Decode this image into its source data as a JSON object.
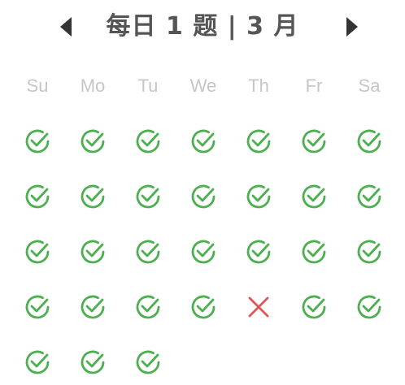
{
  "header": {
    "title": "每日 1 题 | 3 月",
    "prev_icon": "triangle-left-icon",
    "next_icon": "triangle-right-icon"
  },
  "weekdays": [
    "Su",
    "Mo",
    "Tu",
    "We",
    "Th",
    "Fr",
    "Sa"
  ],
  "days": [
    "done",
    "done",
    "done",
    "done",
    "done",
    "done",
    "done",
    "done",
    "done",
    "done",
    "done",
    "done",
    "done",
    "done",
    "done",
    "done",
    "done",
    "done",
    "done",
    "done",
    "done",
    "done",
    "done",
    "done",
    "done",
    "missed",
    "done",
    "done",
    "done",
    "done",
    "done"
  ],
  "colors": {
    "done": "#4caf50",
    "missed": "#e05555",
    "title": "#555555",
    "weekday": "#c6c6c6"
  }
}
